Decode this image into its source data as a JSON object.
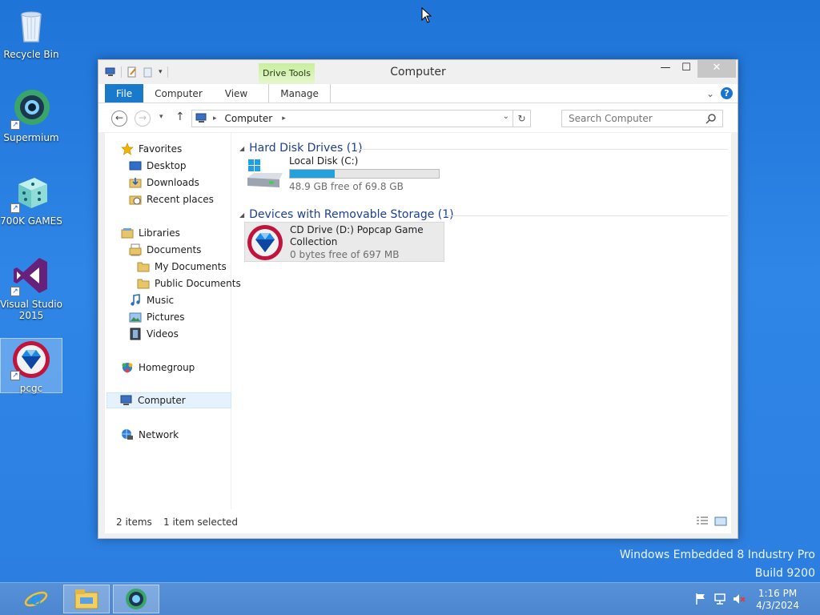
{
  "desktop": {
    "icons": [
      {
        "label": "Recycle Bin"
      },
      {
        "label": "Supermium"
      },
      {
        "label": "700K GAMES"
      },
      {
        "label": "Visual Studio 2015"
      },
      {
        "label": "pcgc"
      }
    ],
    "watermark_line1": "Windows Embedded 8 Industry Pro",
    "watermark_line2": "Build 9200"
  },
  "window": {
    "title": "Computer",
    "context_tab": "Drive Tools",
    "ribbon_tabs": [
      "File",
      "Computer",
      "View",
      "Manage"
    ],
    "address_crumb": "Computer",
    "search_placeholder": "Search Computer"
  },
  "nav": {
    "favorites": "Favorites",
    "desktop": "Desktop",
    "downloads": "Downloads",
    "recent": "Recent places",
    "libraries": "Libraries",
    "documents": "Documents",
    "my_documents": "My Documents",
    "public_documents": "Public Documents",
    "music": "Music",
    "pictures": "Pictures",
    "videos": "Videos",
    "homegroup": "Homegroup",
    "computer": "Computer",
    "network": "Network"
  },
  "groups": {
    "hdd_header": "Hard Disk Drives (1)",
    "removable_header": "Devices with Removable Storage (1)"
  },
  "drives": {
    "c_name": "Local Disk (C:)",
    "c_free": "48.9 GB free of 69.8 GB",
    "c_used_fraction": 0.3,
    "d_name_line1": "CD Drive (D:) Popcap Game",
    "d_name_line2": "Collection",
    "d_free": "0 bytes free of 697 MB"
  },
  "status": {
    "items": "2 items",
    "selected": "1 item selected"
  },
  "taskbar": {
    "time": "1:16 PM",
    "date": "4/3/2024"
  },
  "colors": {
    "accent": "#1979ca",
    "context_tab": "#c9ee9c",
    "progress": "#26a0da"
  }
}
